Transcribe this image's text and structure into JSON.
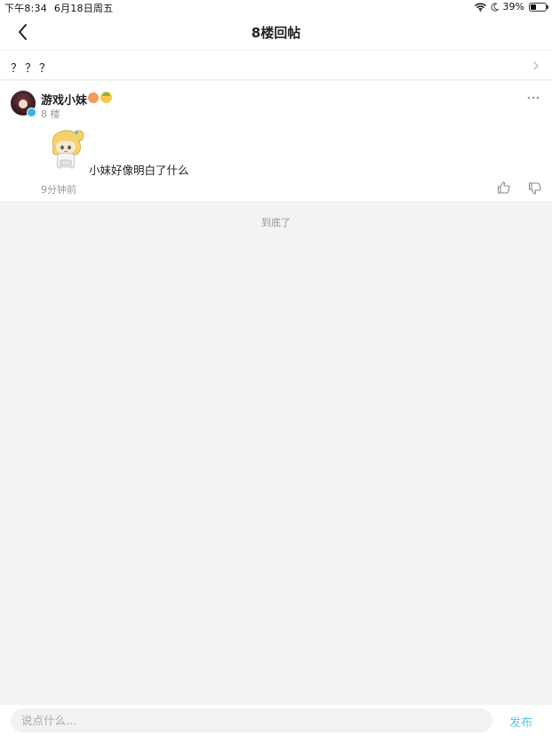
{
  "status_bar": {
    "time": "下午8:34",
    "date": "6月18日周五",
    "battery": "39%",
    "battery_level": 0.39
  },
  "nav": {
    "title": "8楼回帖"
  },
  "thread": {
    "title": "？？？"
  },
  "post": {
    "username": "游戏小妹",
    "floor": "8 楼",
    "content": "小妹好像明白了什么",
    "time": "9分钟前"
  },
  "list_end_text": "到底了",
  "comment_bar": {
    "placeholder": "说点什么...",
    "publish_label": "发布"
  },
  "colors": {
    "accent": "#5fc3ee",
    "verified": "#35b4e8",
    "muted_text": "#999999",
    "background": "#f3f3f3"
  }
}
